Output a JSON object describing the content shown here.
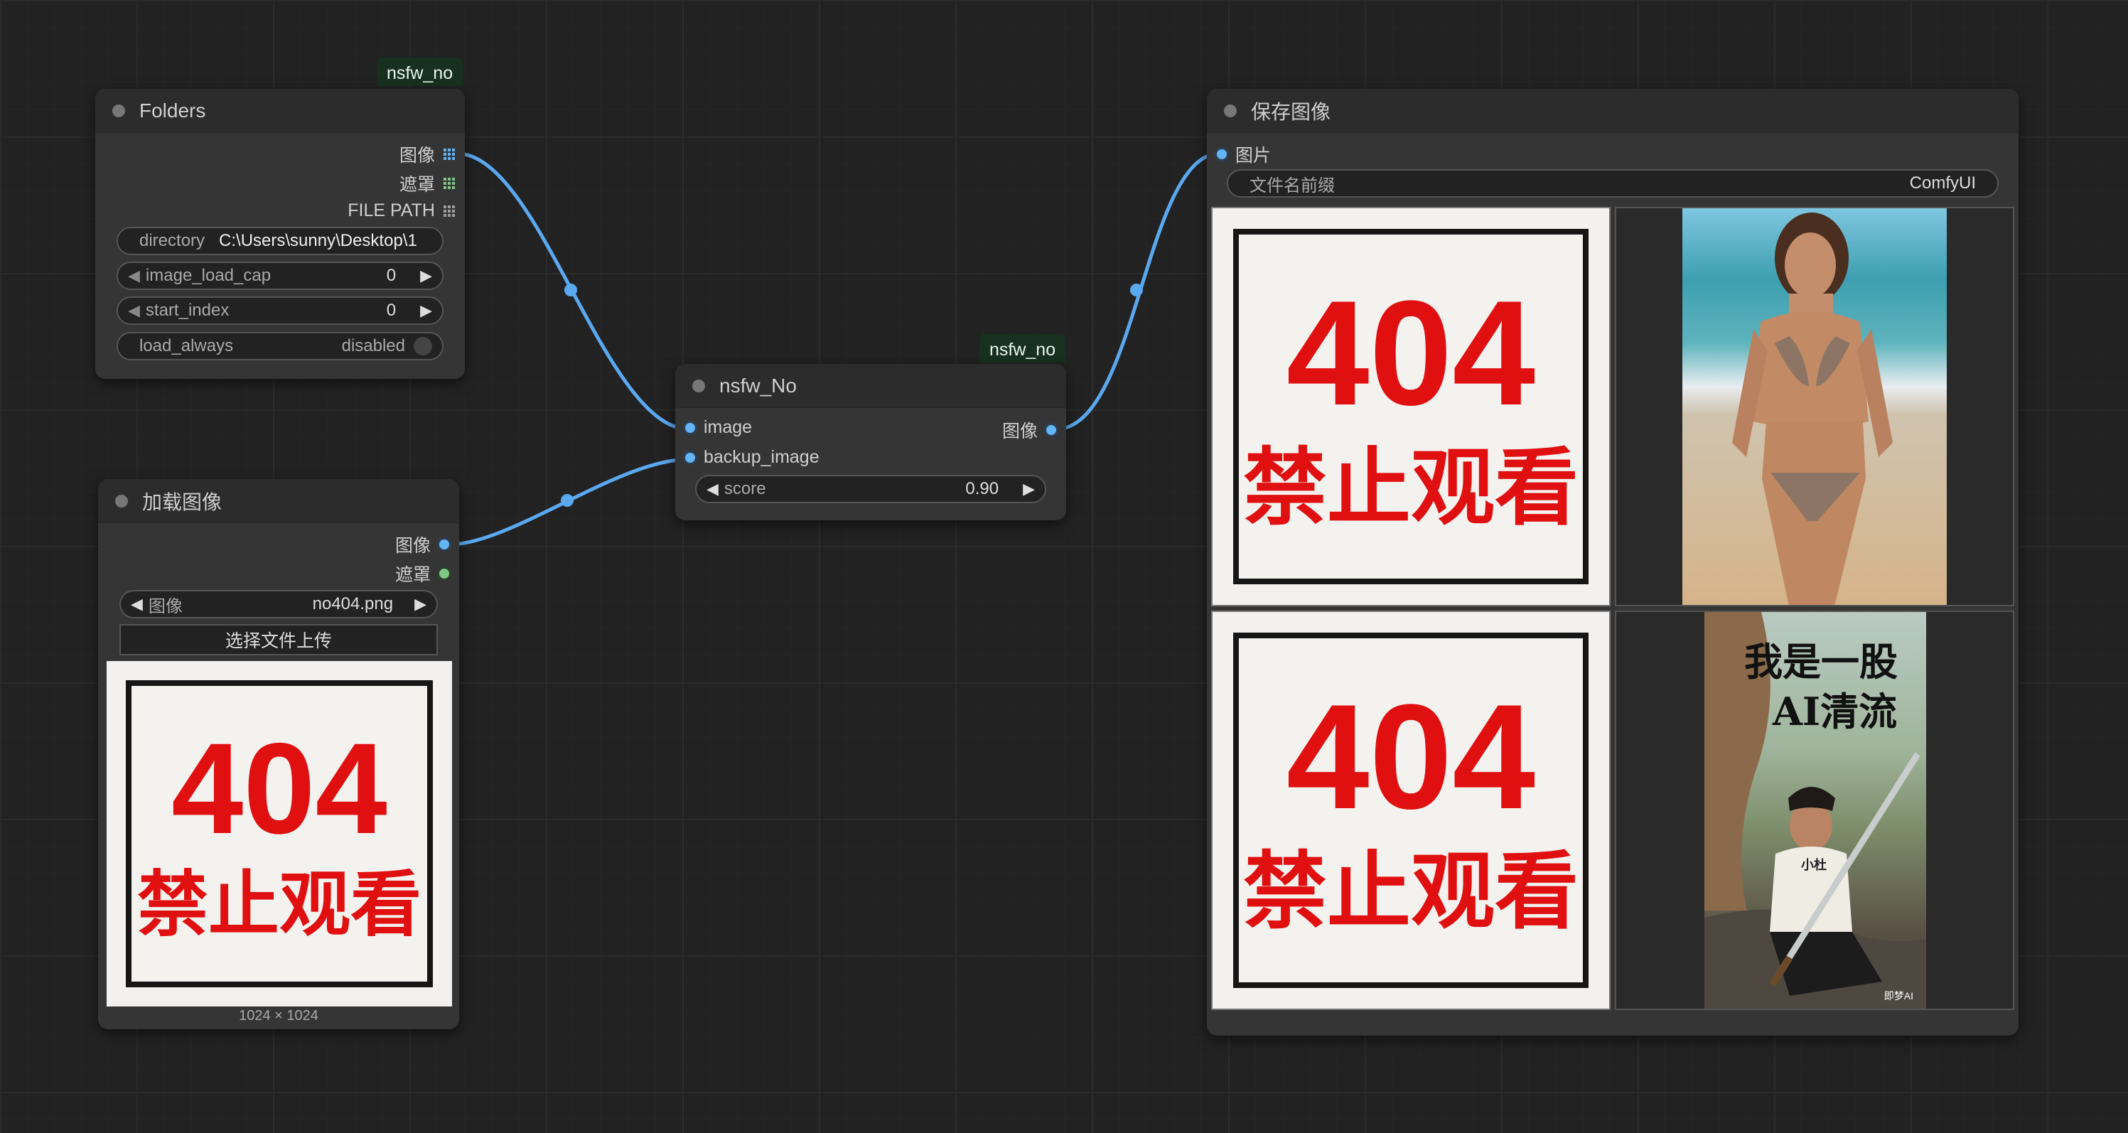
{
  "badges": {
    "folders": "nsfw_no",
    "nsfw": "nsfw_no"
  },
  "folders_node": {
    "title": "Folders",
    "outputs": [
      "图像",
      "遮罩",
      "FILE PATH"
    ],
    "directory": {
      "label": "directory",
      "value": "C:\\Users\\sunny\\Desktop\\1"
    },
    "image_load_cap": {
      "label": "image_load_cap",
      "value": "0"
    },
    "start_index": {
      "label": "start_index",
      "value": "0"
    },
    "load_always": {
      "label": "load_always",
      "value": "disabled"
    }
  },
  "load_image_node": {
    "title": "加载图像",
    "outputs": [
      "图像",
      "遮罩"
    ],
    "image_select": {
      "label": "图像",
      "value": "no404.png"
    },
    "upload_button": "选择文件上传",
    "dims": "1024 × 1024"
  },
  "nsfw_node": {
    "title": "nsfw_No",
    "inputs": [
      "image",
      "backup_image"
    ],
    "output": "图像",
    "score": {
      "label": "score",
      "value": "0.90"
    }
  },
  "save_node": {
    "title": "保存图像",
    "input": "图片",
    "prefix": {
      "label": "文件名前缀",
      "value": "ComfyUI"
    }
  },
  "placeholder_image": {
    "number": "404",
    "text": "禁止观看"
  },
  "photo_overlay": {
    "line1": "我是一股",
    "line2": "AI清流",
    "shirt": "小杜",
    "watermark": "即梦AI"
  },
  "colors": {
    "link": "#64b5f6",
    "badge_bg": "#17301f",
    "node_bg": "#353535",
    "red": "#e01010"
  }
}
